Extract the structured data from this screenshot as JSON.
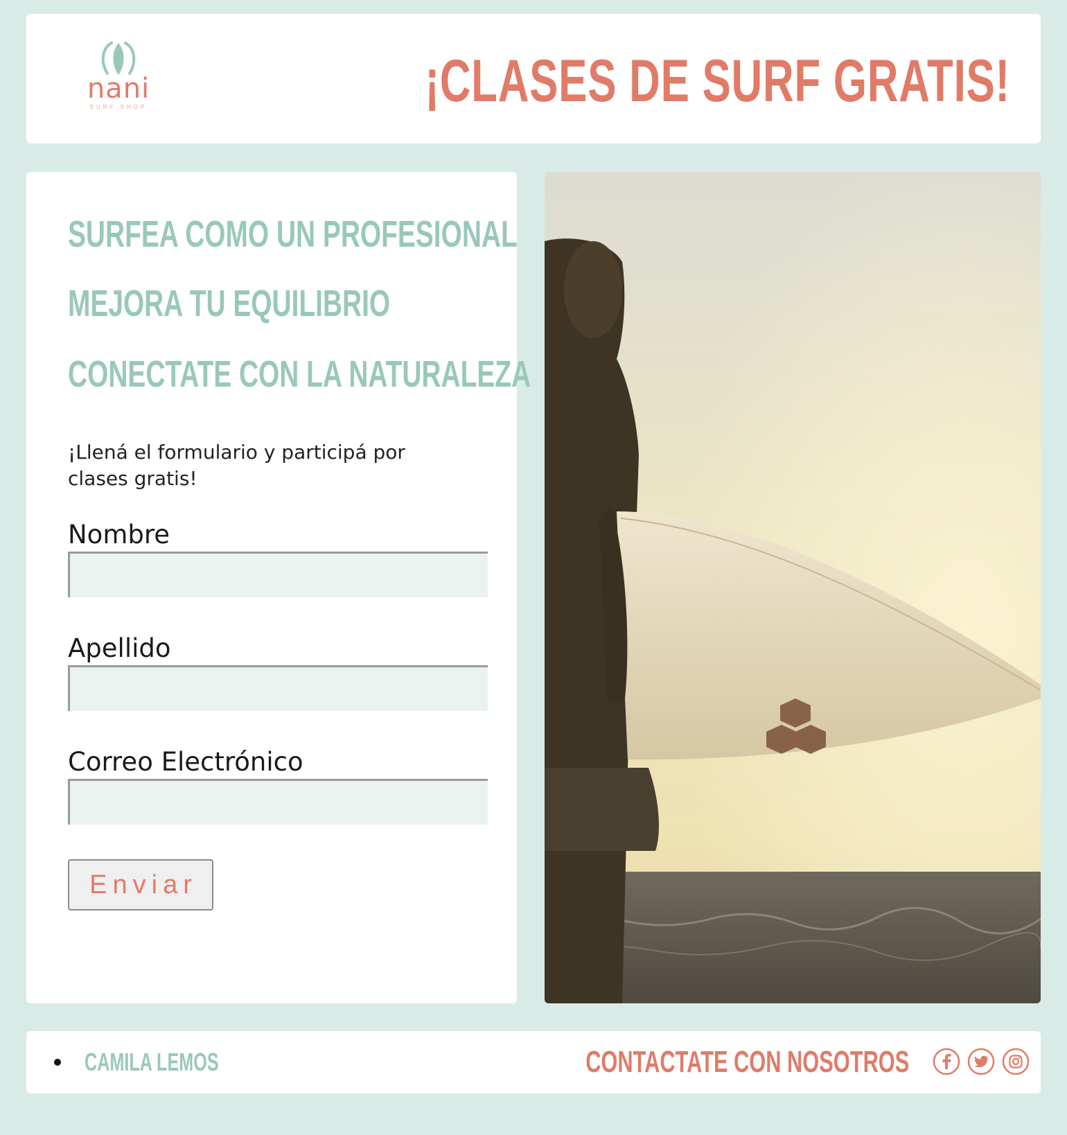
{
  "brand": {
    "logo_word": "nani",
    "logo_tagline": "SURF SHOP"
  },
  "header": {
    "headline": "¡CLASES DE SURF GRATIS!"
  },
  "form": {
    "taglines": [
      "SURFEA COMO UN PROFESIONAL",
      "MEJORA TU EQUILIBRIO",
      "CONECTATE CON LA NATURALEZA"
    ],
    "intro": "¡Llená el formulario y participá por clases gratis!",
    "fields": [
      {
        "label": "Nombre",
        "value": ""
      },
      {
        "label": "Apellido",
        "value": ""
      },
      {
        "label": "Correo Electrónico",
        "value": ""
      }
    ],
    "submit_label": "Enviar"
  },
  "footer": {
    "author": "CAMILA LEMOS",
    "contact": "CONTACTATE CON NOSOTROS",
    "social": [
      "facebook-icon",
      "twitter-icon",
      "instagram-icon"
    ]
  },
  "colors": {
    "background": "#d9ebe7",
    "accent_coral": "#e07b67",
    "accent_mint": "#99c8bb",
    "input_bg": "#eaf3f0"
  }
}
